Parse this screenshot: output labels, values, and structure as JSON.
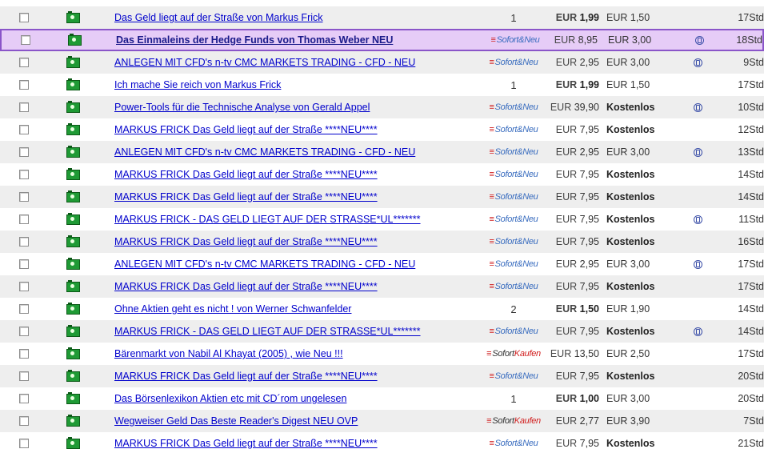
{
  "listing": {
    "rows": [
      {
        "title": "Das Geld liegt auf der Straße von Markus Frick",
        "bids": "1",
        "buy_now": null,
        "price": "1,99",
        "price_bold": true,
        "shipping": "EUR 1,50",
        "paypal": false,
        "time": "17Std"
      },
      {
        "title": "Das Einmaleins der Hedge Funds von Thomas Weber NEU",
        "bids": null,
        "buy_now": "neu",
        "price": "8,95",
        "price_bold": false,
        "shipping": "EUR 3,00",
        "paypal": true,
        "time": "18Std",
        "highlight": true
      },
      {
        "title": "ANLEGEN MIT CFD's n-tv CMC MARKETS TRADING - CFD - NEU",
        "bids": null,
        "buy_now": "neu",
        "price": "2,95",
        "price_bold": false,
        "shipping": "EUR 3,00",
        "paypal": true,
        "time": "9Std"
      },
      {
        "title": "Ich mache Sie reich von Markus Frick",
        "bids": "1",
        "buy_now": null,
        "price": "1,99",
        "price_bold": true,
        "shipping": "EUR 1,50",
        "paypal": false,
        "time": "17Std"
      },
      {
        "title": "Power-Tools für die Technische Analyse von Gerald Appel",
        "bids": null,
        "buy_now": "neu",
        "price": "39,90",
        "price_bold": false,
        "shipping": "Kostenlos",
        "paypal": true,
        "time": "10Std"
      },
      {
        "title": "MARKUS FRICK Das Geld liegt auf der Straße ****NEU****",
        "bids": null,
        "buy_now": "neu",
        "price": "7,95",
        "price_bold": false,
        "shipping": "Kostenlos",
        "paypal": false,
        "time": "12Std"
      },
      {
        "title": "ANLEGEN MIT CFD's n-tv CMC MARKETS TRADING - CFD - NEU",
        "bids": null,
        "buy_now": "neu",
        "price": "2,95",
        "price_bold": false,
        "shipping": "EUR 3,00",
        "paypal": true,
        "time": "13Std"
      },
      {
        "title": "MARKUS FRICK Das Geld liegt auf der Straße ****NEU****",
        "bids": null,
        "buy_now": "neu",
        "price": "7,95",
        "price_bold": false,
        "shipping": "Kostenlos",
        "paypal": false,
        "time": "14Std"
      },
      {
        "title": "MARKUS FRICK Das Geld liegt auf der Straße ****NEU****",
        "bids": null,
        "buy_now": "neu",
        "price": "7,95",
        "price_bold": false,
        "shipping": "Kostenlos",
        "paypal": false,
        "time": "14Std"
      },
      {
        "title": "MARKUS FRICK - DAS GELD LIEGT AUF DER STRASSE*UL*******",
        "bids": null,
        "buy_now": "neu",
        "price": "7,95",
        "price_bold": false,
        "shipping": "Kostenlos",
        "paypal": true,
        "time": "11Std"
      },
      {
        "title": "MARKUS FRICK Das Geld liegt auf der Straße ****NEU****",
        "bids": null,
        "buy_now": "neu",
        "price": "7,95",
        "price_bold": false,
        "shipping": "Kostenlos",
        "paypal": false,
        "time": "16Std"
      },
      {
        "title": "ANLEGEN MIT CFD's n-tv CMC MARKETS TRADING - CFD - NEU",
        "bids": null,
        "buy_now": "neu",
        "price": "2,95",
        "price_bold": false,
        "shipping": "EUR 3,00",
        "paypal": true,
        "time": "17Std"
      },
      {
        "title": "MARKUS FRICK Das Geld liegt auf der Straße ****NEU****",
        "bids": null,
        "buy_now": "neu",
        "price": "7,95",
        "price_bold": false,
        "shipping": "Kostenlos",
        "paypal": false,
        "time": "17Std"
      },
      {
        "title": "Ohne Aktien geht es nicht ! von Werner Schwanfelder",
        "bids": "2",
        "buy_now": null,
        "price": "1,50",
        "price_bold": true,
        "shipping": "EUR 1,90",
        "paypal": false,
        "time": "14Std"
      },
      {
        "title": "MARKUS FRICK - DAS GELD LIEGT AUF DER STRASSE*UL*******",
        "bids": null,
        "buy_now": "neu",
        "price": "7,95",
        "price_bold": false,
        "shipping": "Kostenlos",
        "paypal": true,
        "time": "14Std"
      },
      {
        "title": "Bärenmarkt von Nabil Al Khayat (2005) , wie Neu !!!",
        "bids": null,
        "buy_now": "kaufen",
        "price": "13,50",
        "price_bold": false,
        "shipping": "EUR 2,50",
        "paypal": false,
        "time": "17Std"
      },
      {
        "title": "MARKUS FRICK Das Geld liegt auf der Straße ****NEU****",
        "bids": null,
        "buy_now": "neu",
        "price": "7,95",
        "price_bold": false,
        "shipping": "Kostenlos",
        "paypal": false,
        "time": "20Std"
      },
      {
        "title": "Das Börsenlexikon Aktien etc mit CD´rom ungelesen",
        "bids": "1",
        "buy_now": null,
        "price": "1,00",
        "price_bold": true,
        "shipping": "EUR 3,00",
        "paypal": false,
        "time": "20Std"
      },
      {
        "title": "Wegweiser Geld Das Beste Reader's Digest NEU OVP",
        "bids": null,
        "buy_now": "kaufen",
        "price": "2,77",
        "price_bold": false,
        "shipping": "EUR 3,90",
        "paypal": false,
        "time": "7Std"
      },
      {
        "title": "MARKUS FRICK Das Geld liegt auf der Straße ****NEU****",
        "bids": null,
        "buy_now": "neu",
        "price": "7,95",
        "price_bold": false,
        "shipping": "Kostenlos",
        "paypal": false,
        "time": "21Std"
      }
    ],
    "currency": "EUR",
    "sofort_mark": "≡",
    "sofort_word": "Sofort",
    "neu_word": "&Neu",
    "kaufen_word": "Kaufen",
    "colors": {
      "highlight_bg": "#e6ccf7",
      "highlight_border": "#8a55c9",
      "link": "#0000cc",
      "stripe": "#eeeeee"
    }
  }
}
